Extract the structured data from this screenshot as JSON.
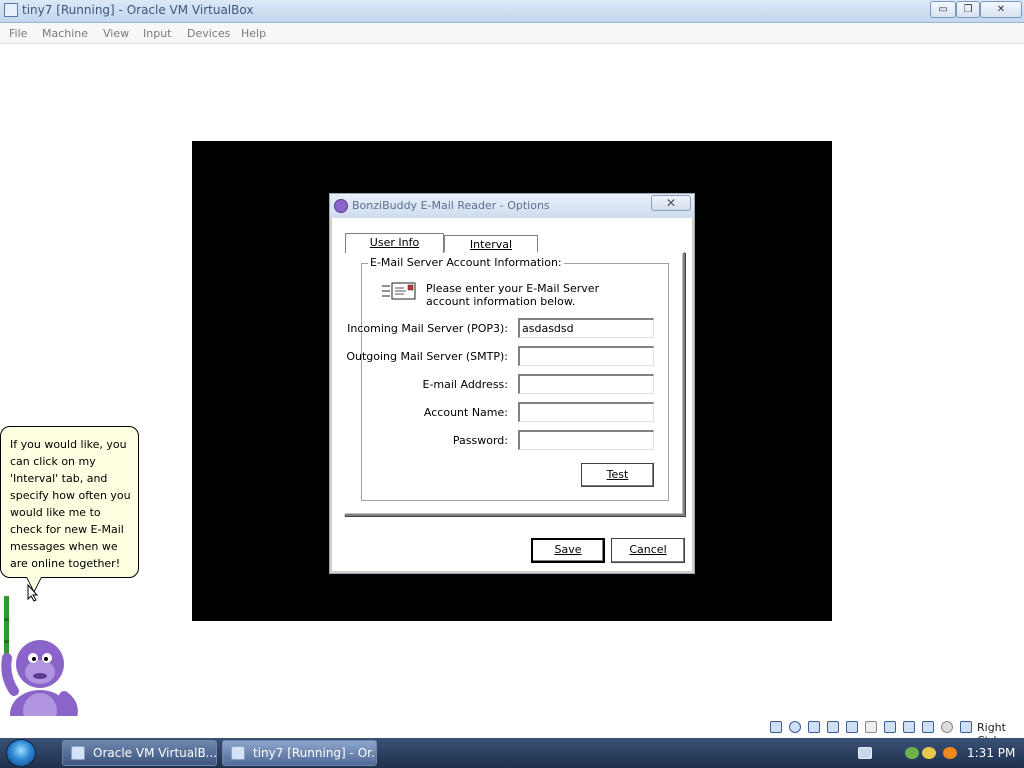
{
  "window": {
    "title": "tiny7 [Running] - Oracle VM VirtualBox",
    "minimize": "▭",
    "restore": "❐",
    "close": "✕"
  },
  "menu": [
    "File",
    "Machine",
    "View",
    "Input",
    "Devices",
    "Help"
  ],
  "dialog": {
    "title": "BonziBuddy E-Mail Reader - Options",
    "close": "✕",
    "tabs": [
      {
        "label": "User Info",
        "selected": true
      },
      {
        "label": "Interval",
        "selected": false
      }
    ],
    "group_label": "E-Mail Server Account Information:",
    "intro": "Please enter your E-Mail Server account information below.",
    "fields": [
      {
        "label": "Incoming Mail Server (POP3):",
        "value": "asdasdsd"
      },
      {
        "label": "Outgoing Mail Server (SMTP):",
        "value": ""
      },
      {
        "label": "E-mail Address:",
        "value": ""
      },
      {
        "label": "Account Name:",
        "value": ""
      },
      {
        "label": "Password:",
        "value": ""
      }
    ],
    "test_button": "Test",
    "save_button": "Save",
    "cancel_button": "Cancel"
  },
  "bubble": {
    "text": "If you would like, you can click on my 'Interval' tab, and specify how often you would like me to check for new E-Mail messages when we are online together!"
  },
  "statusbar": {
    "host_key": "Right Ctrl"
  },
  "taskbar": {
    "buttons": [
      "Oracle VM VirtualB...",
      "tiny7 [Running] - Or..."
    ],
    "clock": "1:31 PM"
  },
  "colors": {
    "guest_background": "#000000",
    "bubble_background": "#ffffe1",
    "taskbar": "#2a3f63",
    "bonzi_purple": "#8a64c8"
  }
}
